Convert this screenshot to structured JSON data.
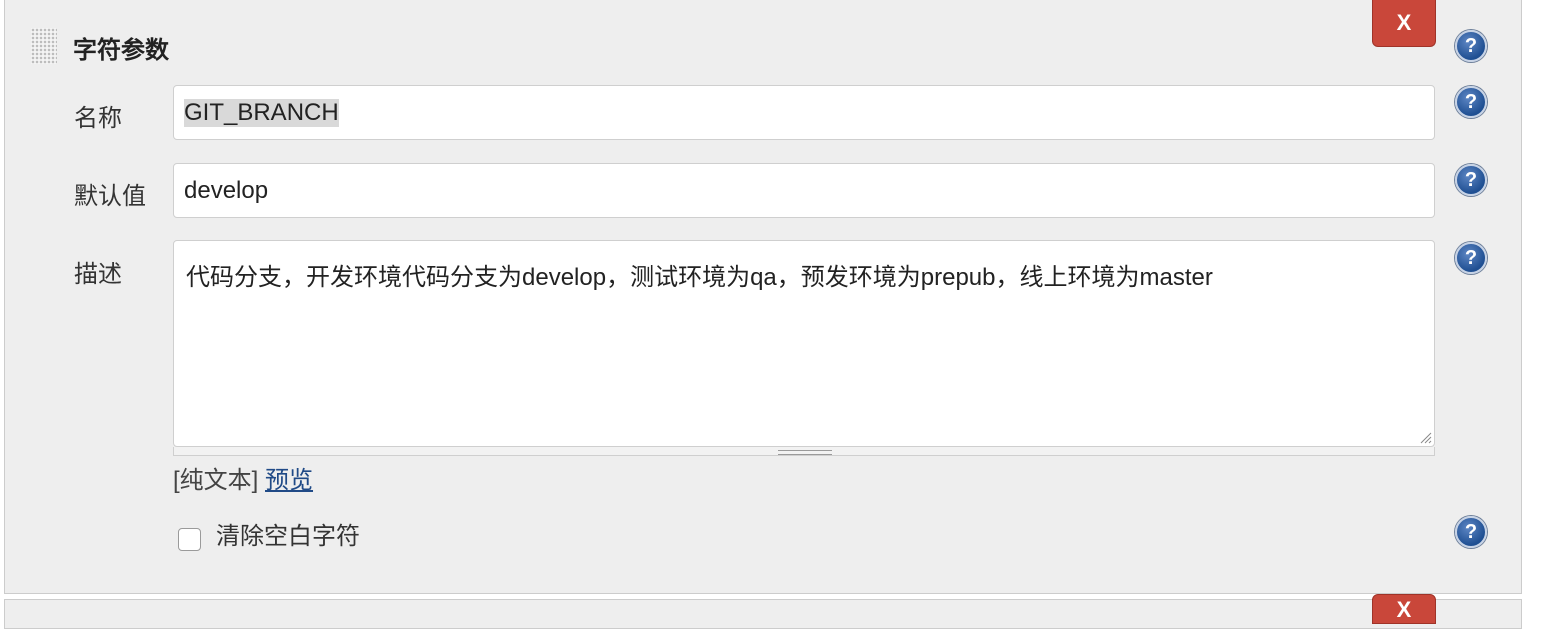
{
  "section": {
    "title": "字符参数",
    "delete_label": "X"
  },
  "fields": {
    "name": {
      "label": "名称",
      "value": "GIT_BRANCH"
    },
    "default_value": {
      "label": "默认值",
      "value": "develop"
    },
    "description": {
      "label": "描述",
      "value": "代码分支，开发环境代码分支为develop，测试环境为qa，预发环境为prepub，线上环境为master"
    }
  },
  "format": {
    "plain_text": "[纯文本]",
    "preview_link": "预览"
  },
  "trim": {
    "label": "清除空白字符",
    "checked": false
  },
  "help": {
    "symbol": "?"
  },
  "next_section": {
    "delete_label": "X"
  },
  "colors": {
    "panel_bg": "#eeeeee",
    "delete_button": "#c9473a",
    "help_icon": "#1f4f92",
    "link": "#204a87"
  }
}
